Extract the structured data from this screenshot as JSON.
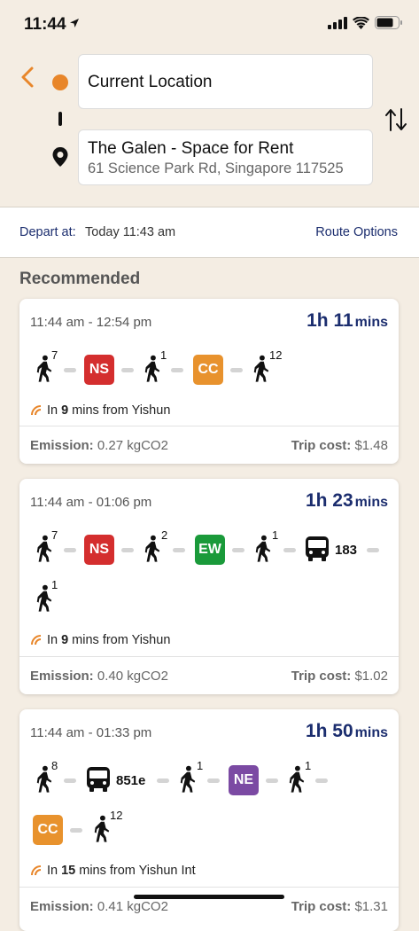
{
  "status": {
    "time": "11:44"
  },
  "search": {
    "origin": "Current Location",
    "destination_name": "The Galen - Space for Rent",
    "destination_address": "61 Science Park Rd, Singapore 117525"
  },
  "depart": {
    "label": "Depart at:",
    "value": "Today 11:43 am",
    "options_label": "Route Options"
  },
  "section_title": "Recommended",
  "colors": {
    "NS": "#d42e2e",
    "EW": "#1a9a3a",
    "CC": "#e8922d",
    "NE": "#7b4aa3",
    "accent": "#1b2d6e"
  },
  "routes": [
    {
      "time": "11:44 am - 12:54 pm",
      "dur_main": "1h 11",
      "dur_unit": "mins",
      "legs": [
        "walk 7",
        "NS",
        "walk 1",
        "CC",
        "walk 12"
      ],
      "walk": [
        "7",
        "1",
        "12"
      ],
      "lines": [
        "NS",
        "CC"
      ],
      "rt_prefix": "In",
      "rt_value": "9",
      "rt_suffix": "mins from Yishun",
      "emission_label": "Emission:",
      "emission": "0.27 kgCO2",
      "cost_label": "Trip cost:",
      "cost": "$1.48"
    },
    {
      "time": "11:44 am - 01:06 pm",
      "dur_main": "1h 23",
      "dur_unit": "mins",
      "walk": [
        "7",
        "2",
        "1",
        "1"
      ],
      "lines": [
        "NS",
        "EW"
      ],
      "bus": [
        "183"
      ],
      "rt_prefix": "In",
      "rt_value": "9",
      "rt_suffix": "mins from Yishun",
      "emission_label": "Emission:",
      "emission": "0.40 kgCO2",
      "cost_label": "Trip cost:",
      "cost": "$1.02"
    },
    {
      "time": "11:44 am - 01:33 pm",
      "dur_main": "1h 50",
      "dur_unit": "mins",
      "walk": [
        "8",
        "1",
        "1",
        "12"
      ],
      "lines": [
        "NE",
        "CC"
      ],
      "bus": [
        "851e"
      ],
      "rt_prefix": "In",
      "rt_value": "15",
      "rt_suffix": "mins from Yishun Int",
      "emission_label": "Emission:",
      "emission": "0.41 kgCO2",
      "cost_label": "Trip cost:",
      "cost": "$1.31"
    }
  ]
}
